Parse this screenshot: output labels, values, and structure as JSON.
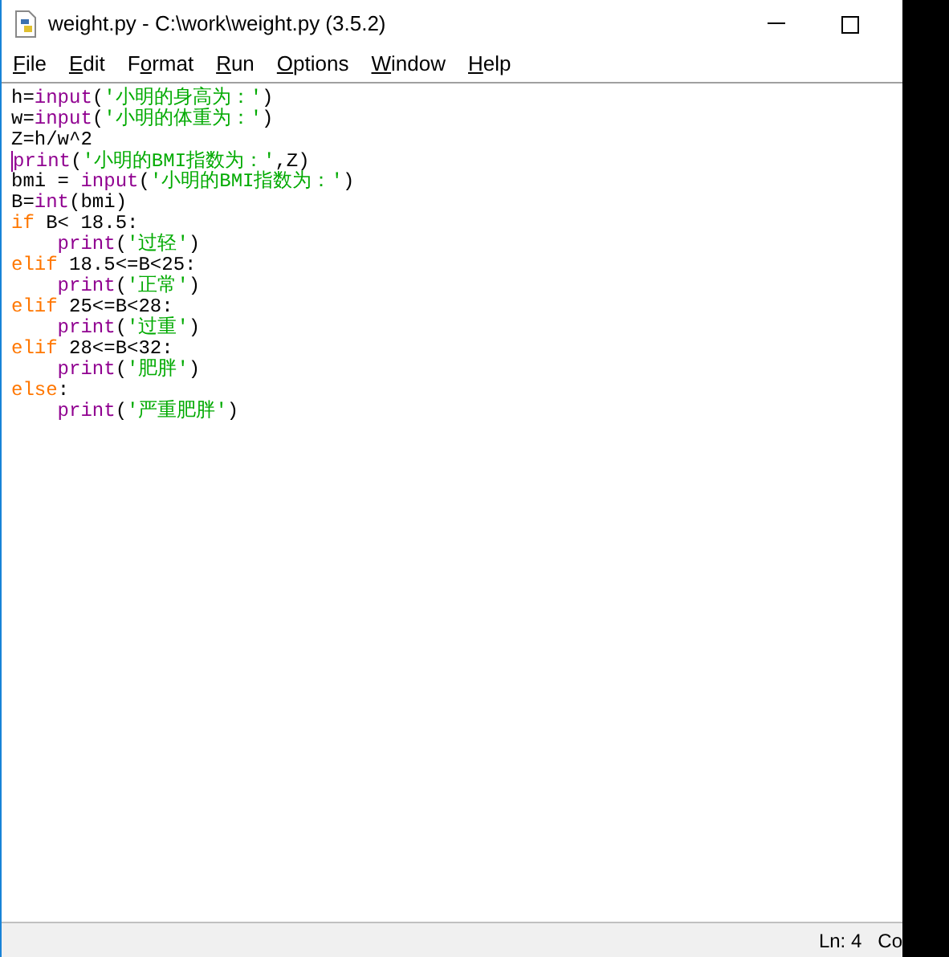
{
  "window": {
    "title": "weight.py - C:\\work\\weight.py (3.5.2)"
  },
  "menu": [
    {
      "key": "F",
      "post": "ile"
    },
    {
      "key": "E",
      "post": "dit"
    },
    {
      "pre": "F",
      "key": "o",
      "post": "rmat"
    },
    {
      "key": "R",
      "post": "un"
    },
    {
      "key": "O",
      "post": "ptions"
    },
    {
      "key": "W",
      "post": "indow"
    },
    {
      "key": "H",
      "post": "elp"
    }
  ],
  "editor": {
    "lines": [
      [
        {
          "kind": "plain",
          "text": "h="
        },
        {
          "kind": "builtin",
          "text": "input"
        },
        {
          "kind": "plain",
          "text": "("
        },
        {
          "kind": "string",
          "text": "'小明的身高为：'"
        },
        {
          "kind": "plain",
          "text": ")"
        }
      ],
      [
        {
          "kind": "plain",
          "text": "w="
        },
        {
          "kind": "builtin",
          "text": "input"
        },
        {
          "kind": "plain",
          "text": "("
        },
        {
          "kind": "string",
          "text": "'小明的体重为：'"
        },
        {
          "kind": "plain",
          "text": ")"
        }
      ],
      [
        {
          "kind": "plain",
          "text": "Z=h/w^2"
        }
      ],
      [
        {
          "kind": "cursor"
        },
        {
          "kind": "builtin",
          "text": "print"
        },
        {
          "kind": "plain",
          "text": "("
        },
        {
          "kind": "string",
          "text": "'小明的BMI指数为：'"
        },
        {
          "kind": "plain",
          "text": ",Z)"
        }
      ],
      [
        {
          "kind": "plain",
          "text": "bmi = "
        },
        {
          "kind": "builtin",
          "text": "input"
        },
        {
          "kind": "plain",
          "text": "("
        },
        {
          "kind": "string",
          "text": "'小明的BMI指数为：'"
        },
        {
          "kind": "plain",
          "text": ")"
        }
      ],
      [
        {
          "kind": "plain",
          "text": "B="
        },
        {
          "kind": "builtin",
          "text": "int"
        },
        {
          "kind": "plain",
          "text": "(bmi)"
        }
      ],
      [
        {
          "kind": "keyword",
          "text": "if"
        },
        {
          "kind": "plain",
          "text": " B< 18.5:"
        }
      ],
      [
        {
          "kind": "builtin",
          "text": "    print"
        },
        {
          "kind": "plain",
          "text": "("
        },
        {
          "kind": "string",
          "text": "'过轻'"
        },
        {
          "kind": "plain",
          "text": ")"
        }
      ],
      [
        {
          "kind": "keyword",
          "text": "elif"
        },
        {
          "kind": "plain",
          "text": " 18.5<=B<25:"
        }
      ],
      [
        {
          "kind": "builtin",
          "text": "    print"
        },
        {
          "kind": "plain",
          "text": "("
        },
        {
          "kind": "string",
          "text": "'正常'"
        },
        {
          "kind": "plain",
          "text": ")"
        }
      ],
      [
        {
          "kind": "keyword",
          "text": "elif"
        },
        {
          "kind": "plain",
          "text": " 25<=B<28:"
        }
      ],
      [
        {
          "kind": "builtin",
          "text": "    print"
        },
        {
          "kind": "plain",
          "text": "("
        },
        {
          "kind": "string",
          "text": "'过重'"
        },
        {
          "kind": "plain",
          "text": ")"
        }
      ],
      [
        {
          "kind": "keyword",
          "text": "elif"
        },
        {
          "kind": "plain",
          "text": " 28<=B<32:"
        }
      ],
      [
        {
          "kind": "builtin",
          "text": "    print"
        },
        {
          "kind": "plain",
          "text": "("
        },
        {
          "kind": "string",
          "text": "'肥胖'"
        },
        {
          "kind": "plain",
          "text": ")"
        }
      ],
      [
        {
          "kind": "keyword",
          "text": "else"
        },
        {
          "kind": "plain",
          "text": ":"
        }
      ],
      [
        {
          "kind": "builtin",
          "text": "    print"
        },
        {
          "kind": "plain",
          "text": "("
        },
        {
          "kind": "string",
          "text": "'严重肥胖'"
        },
        {
          "kind": "plain",
          "text": ")"
        }
      ]
    ]
  },
  "status_bar": {
    "line": "Ln: 4",
    "column": "Co"
  }
}
